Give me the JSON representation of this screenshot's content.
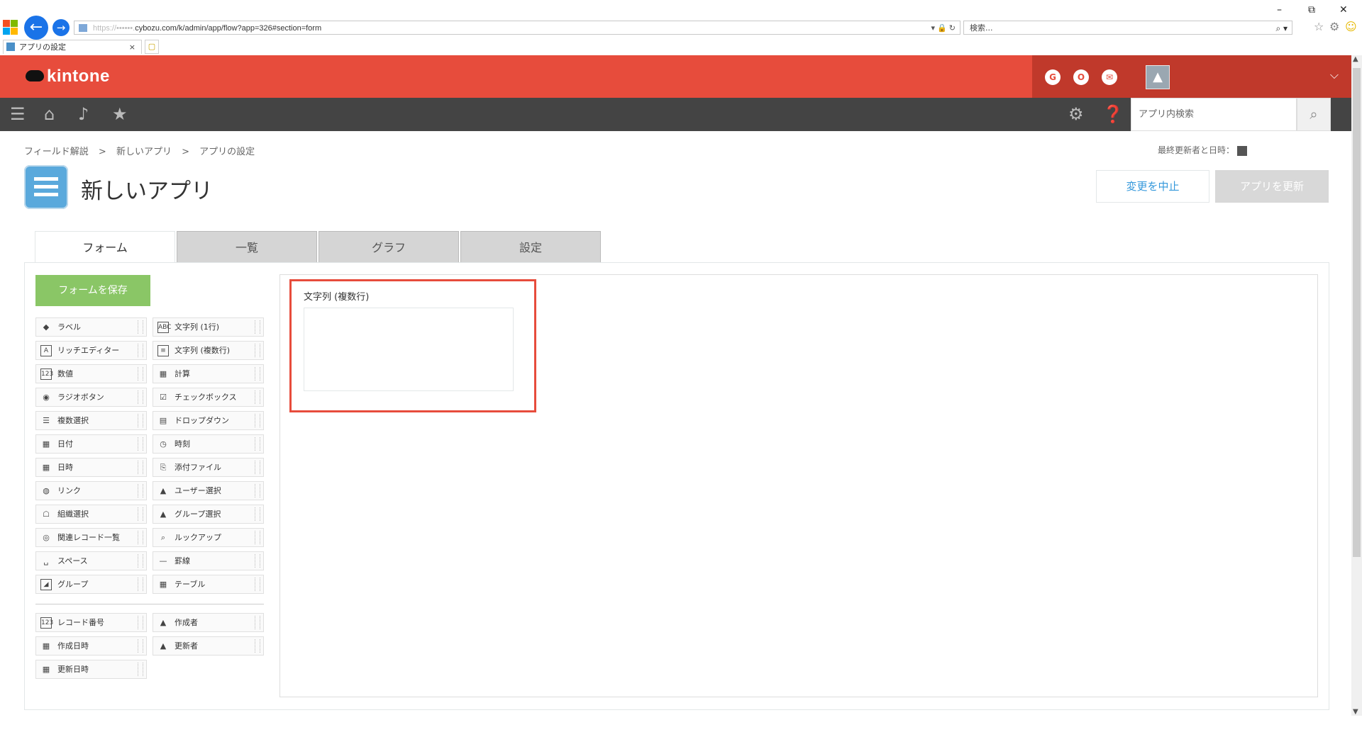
{
  "browser": {
    "address_blurred": "https://••••••.",
    "address_text": "cybozu.com/k/admin/app/flow?app=326#section=form",
    "search_placeholder": "検索...",
    "tab_title": "アプリの設定",
    "tab_close": "×",
    "win_min": "–",
    "win_restore": "⧉",
    "win_close": "✕"
  },
  "header": {
    "brand": "kintone",
    "icons": [
      {
        "name": "garoon-icon",
        "letter": "G"
      },
      {
        "name": "office-icon",
        "letter": "O"
      },
      {
        "name": "mail-icon",
        "letter": "✉"
      }
    ]
  },
  "nav": {
    "search_placeholder": "アプリ内検索"
  },
  "breadcrumb": [
    "フィールド解説",
    ">",
    "新しいアプリ",
    ">",
    "アプリの設定"
  ],
  "last_update_label": "最終更新者と日時：",
  "app_title": "新しいアプリ",
  "actions": {
    "cancel": "変更を中止",
    "update": "アプリを更新"
  },
  "tabs": [
    "フォーム",
    "一覧",
    "グラフ",
    "設定"
  ],
  "save_form": "フォームを保存",
  "fields": [
    {
      "label": "ラベル",
      "icon": "◆",
      "name": "label"
    },
    {
      "label": "文字列 (1行)",
      "icon": "ABC",
      "name": "single-line-text"
    },
    {
      "label": "リッチエディター",
      "icon": "A",
      "name": "rich-editor"
    },
    {
      "label": "文字列 (複数行)",
      "icon": "≡",
      "name": "multi-line-text"
    },
    {
      "label": "数値",
      "icon": "123",
      "name": "number"
    },
    {
      "label": "計算",
      "icon": "▦",
      "name": "calc"
    },
    {
      "label": "ラジオボタン",
      "icon": "◉",
      "name": "radio-button"
    },
    {
      "label": "チェックボックス",
      "icon": "☑",
      "name": "checkbox"
    },
    {
      "label": "複数選択",
      "icon": "☰",
      "name": "multi-select"
    },
    {
      "label": "ドロップダウン",
      "icon": "▤",
      "name": "dropdown"
    },
    {
      "label": "日付",
      "icon": "▦",
      "name": "date"
    },
    {
      "label": "時刻",
      "icon": "◷",
      "name": "time"
    },
    {
      "label": "日時",
      "icon": "▦",
      "name": "datetime"
    },
    {
      "label": "添付ファイル",
      "icon": "⎘",
      "name": "attachment"
    },
    {
      "label": "リンク",
      "icon": "◍",
      "name": "link"
    },
    {
      "label": "ユーザー選択",
      "icon": "▲",
      "name": "user-select"
    },
    {
      "label": "組織選択",
      "icon": "☖",
      "name": "org-select"
    },
    {
      "label": "グループ選択",
      "icon": "▲",
      "name": "group-select"
    },
    {
      "label": "関連レコード一覧",
      "icon": "◎",
      "name": "related-records"
    },
    {
      "label": "ルックアップ",
      "icon": "⌕",
      "name": "lookup"
    },
    {
      "label": "スペース",
      "icon": "␣",
      "name": "space"
    },
    {
      "label": "罫線",
      "icon": "—",
      "name": "border"
    },
    {
      "label": "グループ",
      "icon": "◢",
      "name": "group"
    },
    {
      "label": "テーブル",
      "icon": "▦",
      "name": "table"
    }
  ],
  "system_fields": [
    {
      "label": "レコード番号",
      "icon": "123",
      "name": "record-number"
    },
    {
      "label": "作成者",
      "icon": "▲",
      "name": "creator"
    },
    {
      "label": "作成日時",
      "icon": "▦",
      "name": "created-datetime"
    },
    {
      "label": "更新者",
      "icon": "▲",
      "name": "modifier"
    },
    {
      "label": "更新日時",
      "icon": "▦",
      "name": "updated-datetime"
    }
  ],
  "canvas_field": {
    "label": "文字列 (複数行)",
    "value": ""
  },
  "colors": {
    "header_red": "#e74c3c",
    "header_dark_red": "#c0392b",
    "nav_dark": "#444444",
    "save_green": "#8ac666",
    "link_blue": "#3498db",
    "highlight_frame": "#e74c3c"
  }
}
